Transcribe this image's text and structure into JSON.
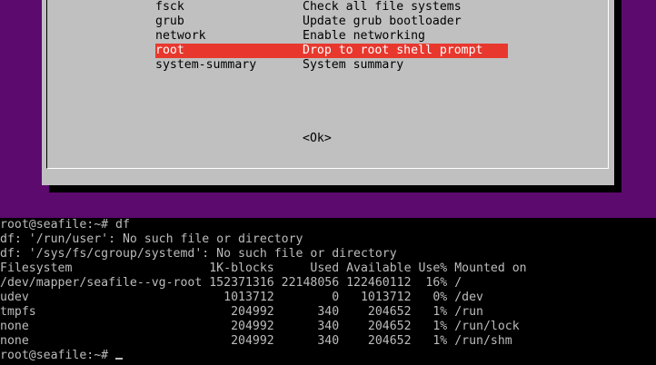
{
  "menu": {
    "items": [
      {
        "key": "fsck",
        "desc": "Check all file systems",
        "selected": false
      },
      {
        "key": "grub",
        "desc": "Update grub bootloader",
        "selected": false
      },
      {
        "key": "network",
        "desc": "Enable networking",
        "selected": false
      },
      {
        "key": "root",
        "desc": "Drop to root shell prompt",
        "selected": true
      },
      {
        "key": "system-summary",
        "desc": "System summary",
        "selected": false
      }
    ],
    "ok_label": "<Ok>"
  },
  "terminal": {
    "lines": [
      "root@seafile:~# df",
      "df: '/run/user': No such file or directory",
      "df: '/sys/fs/cgroup/systemd': No such file or directory",
      "Filesystem                   1K-blocks     Used Available Use% Mounted on",
      "/dev/mapper/seafile--vg-root 152371316 22148056 122460112  16% /",
      "udev                           1013712        0   1013712   0% /dev",
      "tmpfs                           204992      340    204652   1% /run",
      "none                            204992      340    204652   1% /run/lock",
      "none                            204992      340    204652   1% /run/shm"
    ],
    "prompt": "root@seafile:~# "
  },
  "colors": {
    "background_purple": "#5c0a6e",
    "dialog_gray": "#c0c0c0",
    "selection_red": "#e8382e",
    "terminal_text": "#bcbcbc"
  }
}
